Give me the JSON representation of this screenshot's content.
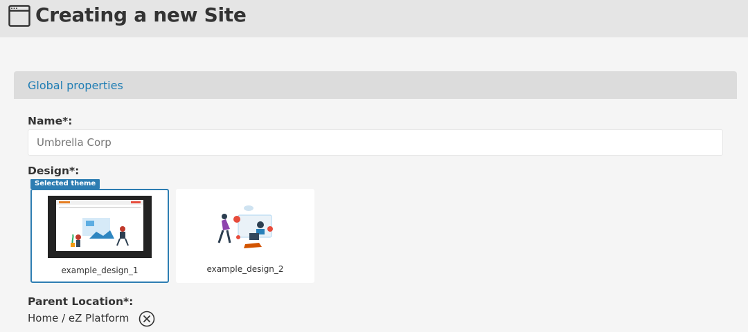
{
  "header": {
    "title": "Creating a new Site",
    "icon": "browser-window-icon"
  },
  "panel": {
    "title": "Global properties"
  },
  "form": {
    "name_label": "Name*:",
    "name_placeholder": "Umbrella Corp",
    "design_label": "Design*:",
    "selected_badge": "Selected theme",
    "designs": [
      {
        "name": "example_design_1",
        "selected": true
      },
      {
        "name": "example_design_2",
        "selected": false
      }
    ],
    "parent_label": "Parent Location*:",
    "parent_value": "Home / eZ Platform",
    "remove_icon": "close-circle-icon"
  },
  "colors": {
    "accent": "#2d7db2",
    "link": "#1f7db4",
    "header_bg": "#e5e5e5",
    "panel_head_bg": "#dcdcdc"
  }
}
